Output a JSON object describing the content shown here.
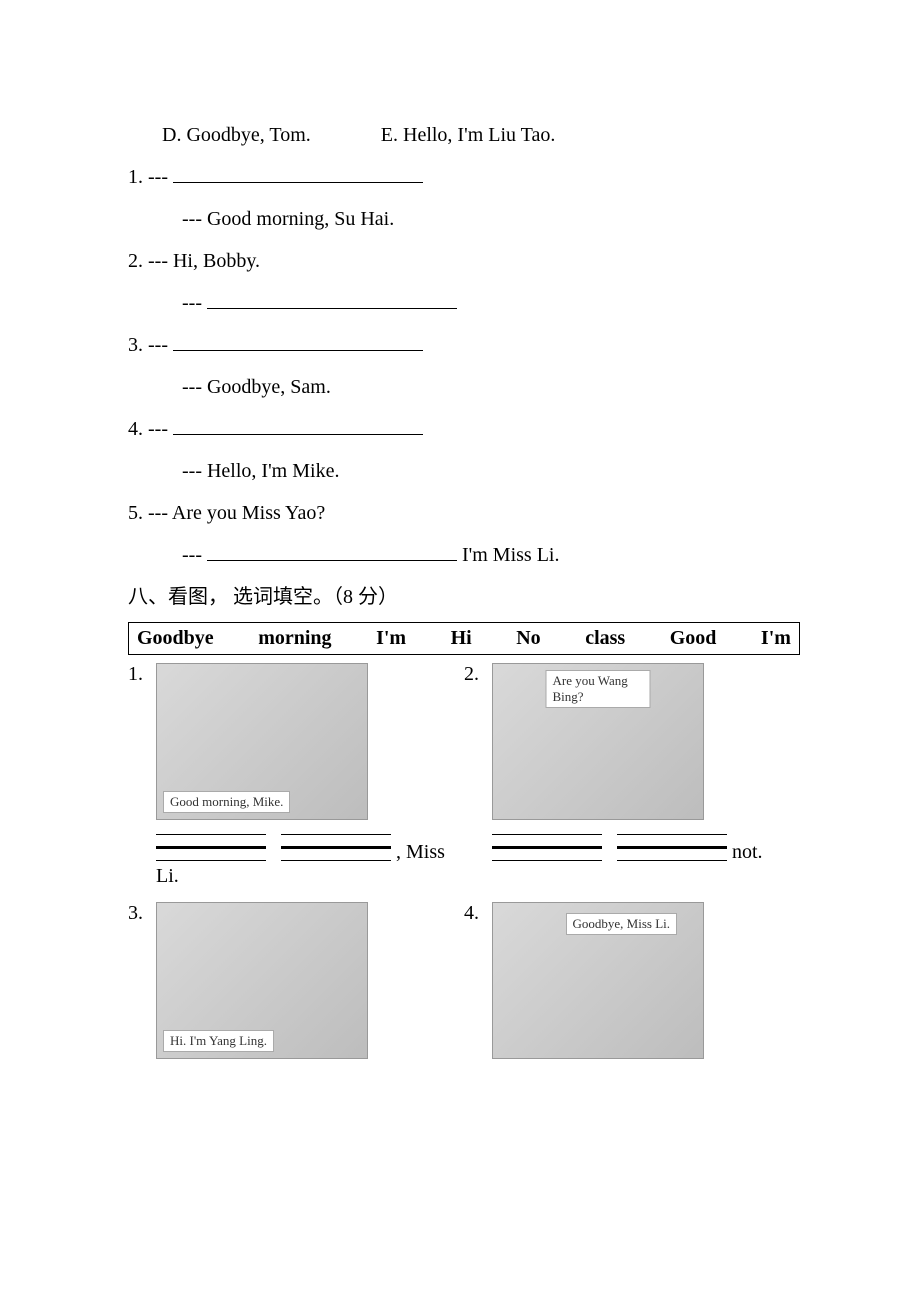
{
  "options": {
    "D": "D. Goodbye, Tom.",
    "E": "E. Hello, I'm Liu Tao."
  },
  "q1": {
    "num": "1. ---",
    "reply": "--- Good morning, Su Hai."
  },
  "q2": {
    "num": "2. --- Hi, Bobby.",
    "reply": "---"
  },
  "q3": {
    "num": "3. ---",
    "reply": "--- Goodbye, Sam."
  },
  "q4": {
    "num": "4. ---",
    "reply": "--- Hello, I'm Mike."
  },
  "q5": {
    "num": "5. --- Are you Miss Yao?",
    "reply": "---",
    "tail": "I'm Miss Li."
  },
  "section8": "八、看图， 选词填空。（8 分）",
  "wordbank": [
    "Goodbye",
    "morning",
    "I'm",
    "Hi",
    "No",
    "class",
    "Good",
    "I'm"
  ],
  "pics": {
    "p1": {
      "num": "1.",
      "caption": "Good morning, Mike.",
      "tail": ", Miss Li."
    },
    "p2": {
      "num": "2.",
      "caption": "Are you Wang Bing?",
      "tail": "not."
    },
    "p3": {
      "num": "3.",
      "caption": "Hi. I'm Yang Ling."
    },
    "p4": {
      "num": "4.",
      "caption": "Goodbye, Miss Li."
    }
  }
}
